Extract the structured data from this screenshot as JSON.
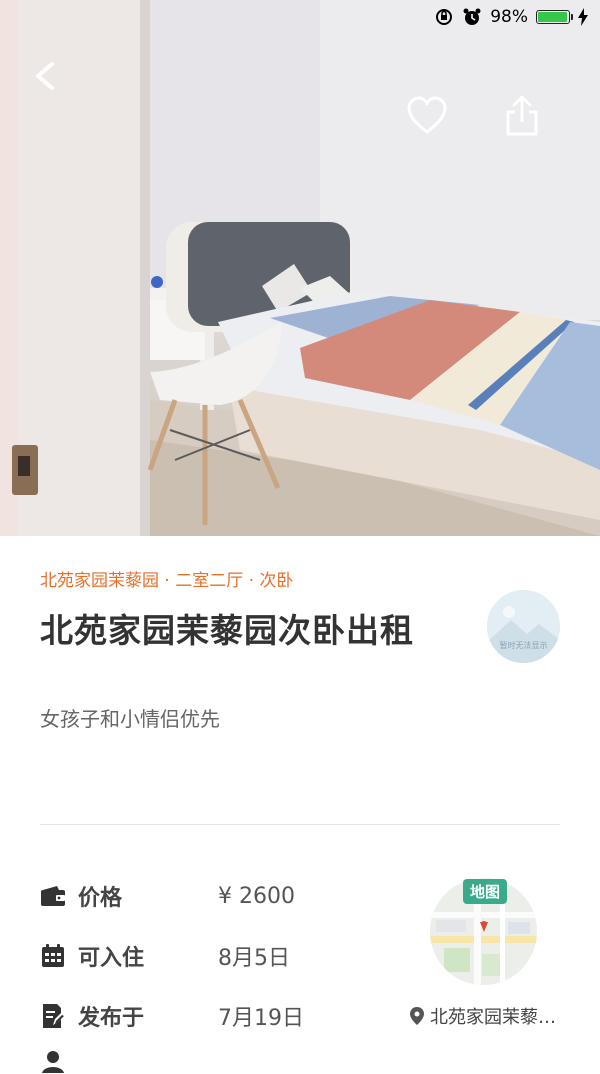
{
  "status_bar": {
    "battery_text": "98%",
    "battery_level": 0.98,
    "icons": [
      "rotation-lock-icon",
      "alarm-icon",
      "charging-icon"
    ]
  },
  "header": {
    "back_icon": "back-chevron-icon",
    "favorite_icon": "heart-icon",
    "share_icon": "share-icon"
  },
  "listing": {
    "breadcrumb": "北苑家园茉藜园 · 二室二厅 · 次卧",
    "title": "北苑家园茉藜园次卧出租",
    "avatar_text": "暂时无法显示",
    "description": "女孩子和小情侣优先"
  },
  "info": {
    "price": {
      "icon": "wallet-icon",
      "label": "价格",
      "value": "¥ 2600"
    },
    "move_in": {
      "icon": "calendar-icon",
      "label": "可入住",
      "value": "8月5日"
    },
    "published": {
      "icon": "edit-document-icon",
      "label": "发布于",
      "value": "7月19日"
    }
  },
  "map": {
    "badge": "地图",
    "address": "北苑家园茉藜…"
  },
  "colors": {
    "accent_orange": "#e5702a",
    "map_badge_green": "#3aaa8a",
    "battery_green": "#35c64a"
  }
}
